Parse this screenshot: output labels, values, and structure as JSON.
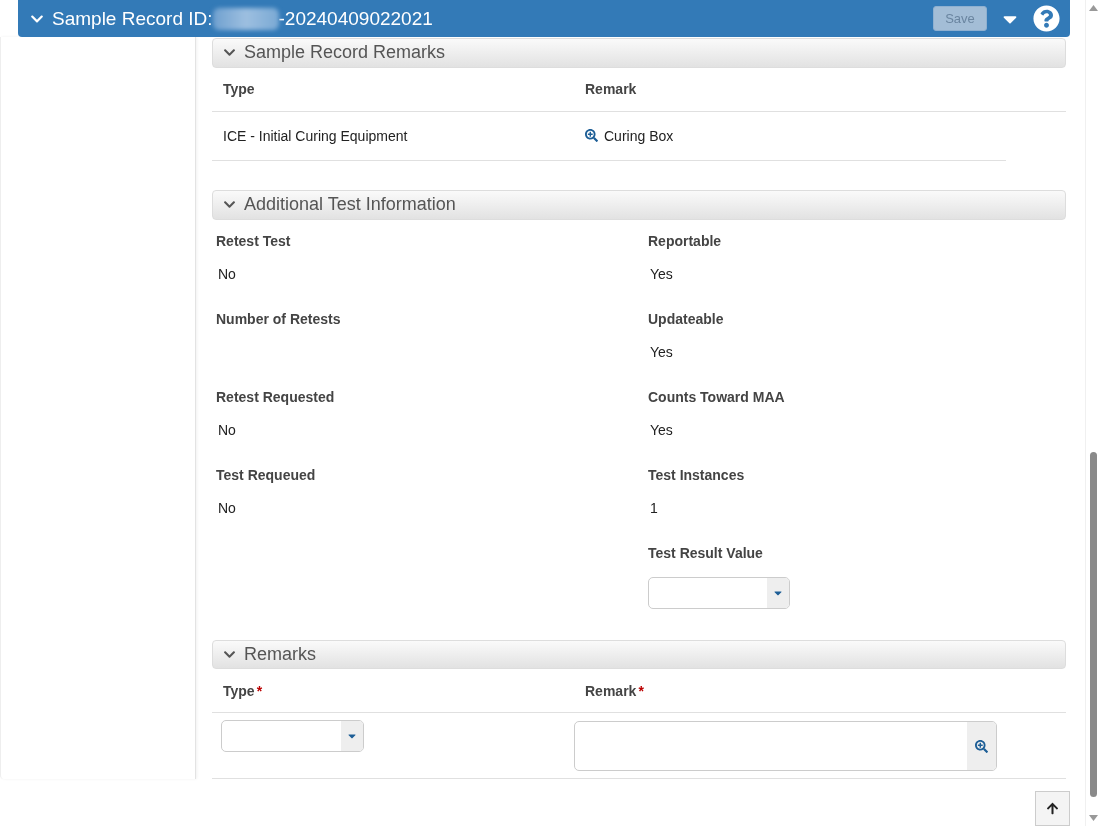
{
  "header": {
    "title_label": "Sample Record ID:",
    "title_suffix": "-20240409022021",
    "save_button": {
      "label": "Save",
      "disabled": true
    }
  },
  "sections": [
    {
      "kind": "table",
      "title": "Sample Record Remarks",
      "expanded": true,
      "columns": [
        "Type",
        "Remark"
      ],
      "rows": [
        {
          "type": "ICE - Initial Curing Equipment",
          "remark": "Curing Box"
        }
      ]
    },
    {
      "kind": "fields",
      "title": "Additional Test Information",
      "expanded": true,
      "rows": [
        {
          "left": {
            "label": "Retest Test",
            "value": "No"
          },
          "right": {
            "label": "Reportable",
            "value": "Yes"
          }
        },
        {
          "left": {
            "label": "Number of Retests"
          },
          "right": {
            "label": "Updateable",
            "value": "Yes"
          }
        },
        {
          "left": {
            "label": "Retest Requested",
            "value": "No"
          },
          "right": {
            "label": "Counts Toward MAA",
            "value": "Yes"
          }
        },
        {
          "left": {
            "label": "Test Requeued",
            "value": "No"
          },
          "right": {
            "label": "Test Instances",
            "value": "1"
          }
        },
        {
          "right": {
            "label": "Test Result Value",
            "kind": "select"
          }
        }
      ]
    },
    {
      "kind": "form",
      "title": "Remarks",
      "expanded": true,
      "required_mark": "*",
      "columns": [
        {
          "label": "Type",
          "required": true,
          "kind": "select"
        },
        {
          "label": "Remark",
          "required": true,
          "kind": "lookup"
        }
      ]
    }
  ]
}
